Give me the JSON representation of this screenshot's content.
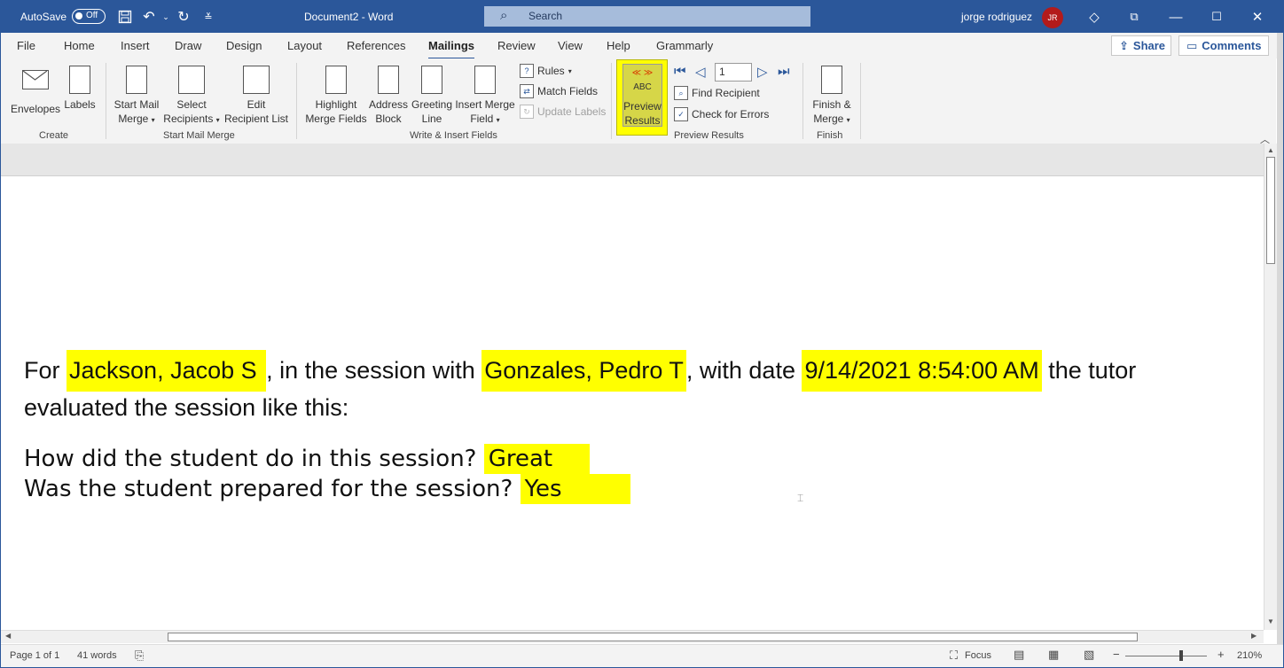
{
  "titlebar": {
    "autosave_label": "AutoSave",
    "autosave_state": "Off",
    "doc_title": "Document2 - Word",
    "search_placeholder": "Search",
    "user_name": "jorge rodriguez",
    "user_initials": "JR",
    "accent_color": "#2b579a"
  },
  "tabs": [
    {
      "label": "File"
    },
    {
      "label": "Home"
    },
    {
      "label": "Insert"
    },
    {
      "label": "Draw"
    },
    {
      "label": "Design"
    },
    {
      "label": "Layout"
    },
    {
      "label": "References"
    },
    {
      "label": "Mailings",
      "active": true
    },
    {
      "label": "Review"
    },
    {
      "label": "View"
    },
    {
      "label": "Help"
    },
    {
      "label": "Grammarly"
    }
  ],
  "actions": {
    "share": "Share",
    "comments": "Comments"
  },
  "ribbon": {
    "create": {
      "label": "Create",
      "envelopes": "Envelopes",
      "labels": "Labels"
    },
    "start_mail_merge": {
      "label": "Start Mail Merge",
      "start_1": "Start Mail",
      "start_2": "Merge",
      "select_1": "Select",
      "select_2": "Recipients",
      "edit_1": "Edit",
      "edit_2": "Recipient List"
    },
    "write_insert": {
      "label": "Write & Insert Fields",
      "highlight_1": "Highlight",
      "highlight_2": "Merge Fields",
      "address_1": "Address",
      "address_2": "Block",
      "greeting_1": "Greeting",
      "greeting_2": "Line",
      "insert_1": "Insert Merge",
      "insert_2": "Field",
      "rules": "Rules",
      "match_fields": "Match Fields",
      "update_labels": "Update Labels"
    },
    "preview_results": {
      "label": "Preview Results",
      "icon_text": "ABC",
      "preview_1": "Preview",
      "preview_2": "Results",
      "record_number": "1",
      "find_recipient": "Find Recipient",
      "check_errors": "Check for Errors",
      "highlight_color": "#ffff00"
    },
    "finish": {
      "label": "Finish",
      "finish_1": "Finish &",
      "finish_2": "Merge"
    }
  },
  "document": {
    "line1": {
      "t1": "For ",
      "f1": "Jackson, Jacob S ",
      "t2": ", in the session with ",
      "f2": "Gonzales, Pedro T",
      "t3": ", with date ",
      "f3": "9/14/2021 8:54:00 AM",
      "t4": " the tutor"
    },
    "line2": "evaluated the session like this:",
    "q1": "How did the student do in this session? ",
    "a1": "Great",
    "q2": "Was the student prepared for the session? ",
    "a2": "Yes"
  },
  "status": {
    "page": "Page 1 of 1",
    "words": "41 words",
    "focus": "Focus",
    "zoom": "210%"
  }
}
